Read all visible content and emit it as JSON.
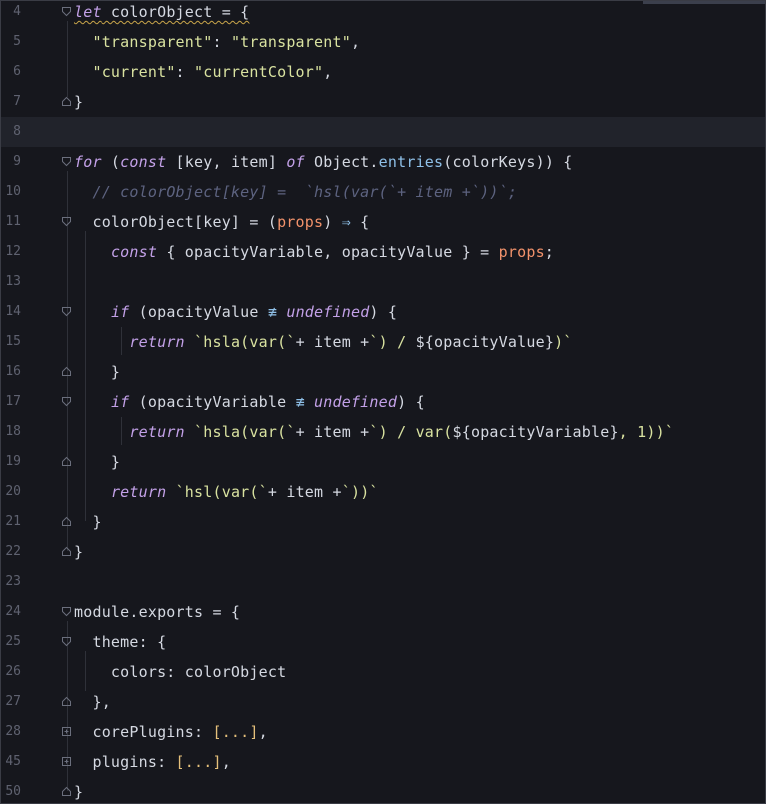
{
  "editor": {
    "lines": [
      {
        "num": "4",
        "fold": "open",
        "parts": [
          {
            "t": "let",
            "c": "kw squig"
          },
          {
            "t": " colorObject = {",
            "c": "p squig"
          }
        ]
      },
      {
        "num": "5",
        "fold": "",
        "parts": [
          {
            "t": "  "
          },
          {
            "t": "\"transparent\"",
            "c": "str"
          },
          {
            "t": ": ",
            "c": "p"
          },
          {
            "t": "\"transparent\"",
            "c": "str"
          },
          {
            "t": ",",
            "c": "p"
          }
        ]
      },
      {
        "num": "6",
        "fold": "",
        "parts": [
          {
            "t": "  "
          },
          {
            "t": "\"current\"",
            "c": "str"
          },
          {
            "t": ": ",
            "c": "p"
          },
          {
            "t": "\"currentColor\"",
            "c": "str"
          },
          {
            "t": ",",
            "c": "p"
          }
        ]
      },
      {
        "num": "7",
        "fold": "close",
        "parts": [
          {
            "t": "}",
            "c": "p"
          }
        ]
      },
      {
        "num": "8",
        "fold": "",
        "current": true,
        "parts": []
      },
      {
        "num": "9",
        "fold": "open",
        "parts": [
          {
            "t": "for",
            "c": "kw"
          },
          {
            "t": " (",
            "c": "p"
          },
          {
            "t": "const",
            "c": "kw"
          },
          {
            "t": " [key, item] ",
            "c": "p"
          },
          {
            "t": "of",
            "c": "kw"
          },
          {
            "t": " Object.",
            "c": "p"
          },
          {
            "t": "entries",
            "c": "fn"
          },
          {
            "t": "(colorKeys)) {",
            "c": "p"
          }
        ]
      },
      {
        "num": "10",
        "fold": "",
        "parts": [
          {
            "t": "  "
          },
          {
            "t": "// colorObject[key] =  `hsl(var(`+ item +`))`;",
            "c": "com"
          }
        ]
      },
      {
        "num": "11",
        "fold": "open",
        "parts": [
          {
            "t": "  colorObject[key] = (",
            "c": "p"
          },
          {
            "t": "props",
            "c": "param"
          },
          {
            "t": ") ",
            "c": "p"
          },
          {
            "t": "⇒",
            "c": "op"
          },
          {
            "t": " {",
            "c": "p"
          }
        ]
      },
      {
        "num": "12",
        "fold": "",
        "parts": [
          {
            "t": "    "
          },
          {
            "t": "const",
            "c": "kw"
          },
          {
            "t": " { opacityVariable, opacityValue } = ",
            "c": "p"
          },
          {
            "t": "props",
            "c": "param"
          },
          {
            "t": ";",
            "c": "p"
          }
        ]
      },
      {
        "num": "13",
        "fold": "",
        "parts": []
      },
      {
        "num": "14",
        "fold": "open",
        "parts": [
          {
            "t": "    "
          },
          {
            "t": "if",
            "c": "kw"
          },
          {
            "t": " (opacityValue ",
            "c": "p"
          },
          {
            "t": "≢",
            "c": "op"
          },
          {
            "t": " ",
            "c": "p"
          },
          {
            "t": "undefined",
            "c": "kw"
          },
          {
            "t": ") {",
            "c": "p"
          }
        ]
      },
      {
        "num": "15",
        "fold": "",
        "parts": [
          {
            "t": "      "
          },
          {
            "t": "return",
            "c": "kw"
          },
          {
            "t": " ",
            "c": "p"
          },
          {
            "t": "`hsla(var(`",
            "c": "str"
          },
          {
            "t": "+ item +",
            "c": "p"
          },
          {
            "t": "`) / ",
            "c": "str"
          },
          {
            "t": "${",
            "c": "p"
          },
          {
            "t": "opacityValue",
            "c": "p"
          },
          {
            "t": "}",
            "c": "p"
          },
          {
            "t": ")`",
            "c": "str"
          }
        ]
      },
      {
        "num": "16",
        "fold": "close",
        "parts": [
          {
            "t": "    }",
            "c": "p"
          }
        ]
      },
      {
        "num": "17",
        "fold": "open",
        "parts": [
          {
            "t": "    "
          },
          {
            "t": "if",
            "c": "kw"
          },
          {
            "t": " (opacityVariable ",
            "c": "p"
          },
          {
            "t": "≢",
            "c": "op"
          },
          {
            "t": " ",
            "c": "p"
          },
          {
            "t": "undefined",
            "c": "kw"
          },
          {
            "t": ") {",
            "c": "p"
          }
        ]
      },
      {
        "num": "18",
        "fold": "",
        "parts": [
          {
            "t": "      "
          },
          {
            "t": "return",
            "c": "kw"
          },
          {
            "t": " ",
            "c": "p"
          },
          {
            "t": "`hsla(var(`",
            "c": "str"
          },
          {
            "t": "+ item +",
            "c": "p"
          },
          {
            "t": "`) / var(",
            "c": "str"
          },
          {
            "t": "${",
            "c": "p"
          },
          {
            "t": "opacityVariable",
            "c": "p"
          },
          {
            "t": "}",
            "c": "p"
          },
          {
            "t": ", 1))`",
            "c": "str"
          }
        ]
      },
      {
        "num": "19",
        "fold": "close",
        "parts": [
          {
            "t": "    }",
            "c": "p"
          }
        ]
      },
      {
        "num": "20",
        "fold": "",
        "parts": [
          {
            "t": "    "
          },
          {
            "t": "return",
            "c": "kw"
          },
          {
            "t": " ",
            "c": "p"
          },
          {
            "t": "`hsl(var(`",
            "c": "str"
          },
          {
            "t": "+ item +",
            "c": "p"
          },
          {
            "t": "`))`",
            "c": "str"
          }
        ]
      },
      {
        "num": "21",
        "fold": "close",
        "parts": [
          {
            "t": "  }",
            "c": "p"
          }
        ]
      },
      {
        "num": "22",
        "fold": "close",
        "parts": [
          {
            "t": "}",
            "c": "p"
          }
        ]
      },
      {
        "num": "23",
        "fold": "",
        "parts": []
      },
      {
        "num": "24",
        "fold": "open",
        "parts": [
          {
            "t": "module.exports = {",
            "c": "p"
          }
        ]
      },
      {
        "num": "25",
        "fold": "open",
        "parts": [
          {
            "t": "  theme: {",
            "c": "p"
          }
        ]
      },
      {
        "num": "26",
        "fold": "",
        "parts": [
          {
            "t": "    colors: colorObject",
            "c": "p"
          }
        ]
      },
      {
        "num": "27",
        "fold": "close",
        "parts": [
          {
            "t": "  },",
            "c": "p"
          }
        ]
      },
      {
        "num": "28",
        "fold": "plus",
        "parts": [
          {
            "t": "  corePlugins: ",
            "c": "p"
          },
          {
            "t": "[...]",
            "c": "fold-ph"
          },
          {
            "t": ",",
            "c": "p"
          }
        ]
      },
      {
        "num": "45",
        "fold": "plus",
        "parts": [
          {
            "t": "  plugins: ",
            "c": "p"
          },
          {
            "t": "[...]",
            "c": "fold-ph"
          },
          {
            "t": ",",
            "c": "p"
          }
        ]
      },
      {
        "num": "50",
        "fold": "close",
        "parts": [
          {
            "t": "}",
            "c": "p"
          }
        ]
      }
    ]
  }
}
